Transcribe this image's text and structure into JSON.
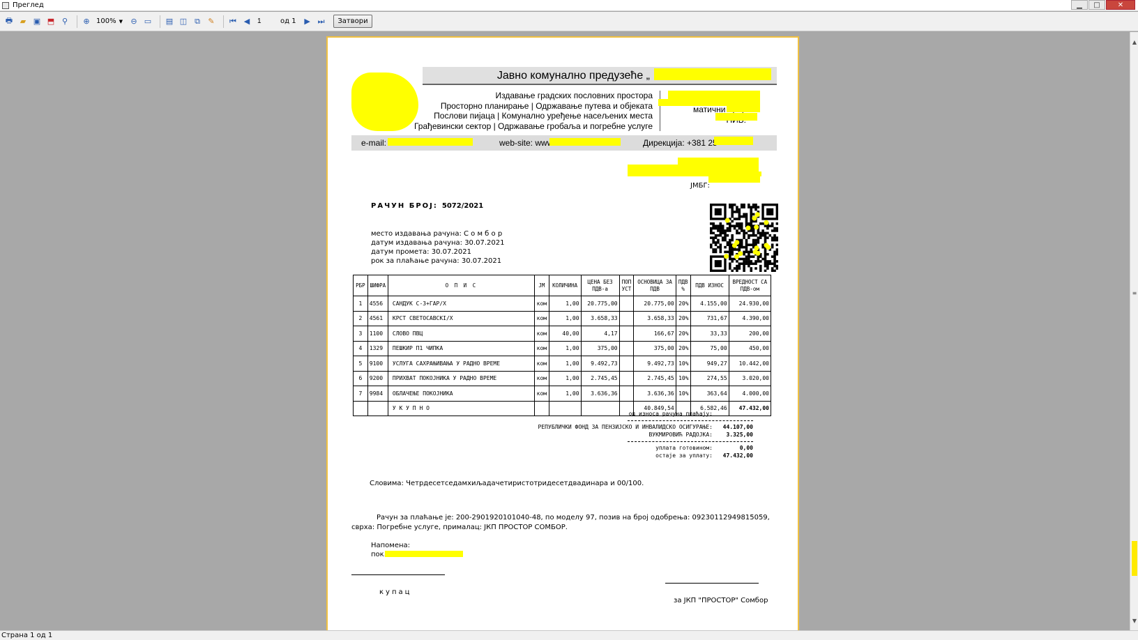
{
  "window": {
    "title": "Преглед",
    "zoom": "100%",
    "page_current": "1",
    "page_of": "од 1",
    "close_label": "Затвори",
    "status": "Страна 1 од 1"
  },
  "header": {
    "company": "Јавно комунално предузеће „",
    "services": [
      "Издавање градских пословних простора",
      "Просторно планирање | Одржавање путева и објеката",
      "Послови пијаца | Комунално уређење насељених места",
      "Грађевински сектор | Одржавање гробаља и погребне услуге"
    ],
    "maticni": "матични број:",
    "pib": "ПИБ:",
    "email": "e-mail:",
    "website": "web-site: www.",
    "direkcija": "Дирекција: +381 25"
  },
  "customer": {
    "jmbg": "ЈМБГ:"
  },
  "invoice": {
    "title": "РАЧУН БРОЈ:",
    "number": "5072/2021",
    "place": "место издавања рачуна: С о м б о р",
    "issue_date": "датум издавања рачуна: 30.07.2021",
    "turnover_date": "датум промета: 30.07.2021",
    "due_date": "рок за плаћање рачуна: 30.07.2021"
  },
  "table": {
    "headers": [
      "РБР",
      "ШИФРА",
      "О  П  И  С",
      "ЈМ",
      "КОЛИЧИНА",
      "ЦЕНА БЕЗ ПДВ-а",
      "ПОП УСТ",
      "ОСНОВИЦА ЗА ПДВ",
      "ПДВ %",
      "ПДВ ИЗНОС",
      "ВРЕДНОСТ СА ПДВ-ом"
    ],
    "rows": [
      [
        "1",
        "4556",
        "САНДУК С-3+ГАР/Х",
        "ком",
        "1,00",
        "20.775,00",
        "",
        "20.775,00",
        "20%",
        "4.155,00",
        "24.930,00"
      ],
      [
        "2",
        "4561",
        "КРСТ СВЕТОСАВСКI/Х",
        "ком",
        "1,00",
        "3.658,33",
        "",
        "3.658,33",
        "20%",
        "731,67",
        "4.390,00"
      ],
      [
        "3",
        "1100",
        "СЛОВО ПВЦ",
        "ком",
        "40,00",
        "4,17",
        "",
        "166,67",
        "20%",
        "33,33",
        "200,00"
      ],
      [
        "4",
        "1329",
        "ПЕШКИР П1 ЧИПКА",
        "ком",
        "1,00",
        "375,00",
        "",
        "375,00",
        "20%",
        "75,00",
        "450,00"
      ],
      [
        "5",
        "9100",
        "УСЛУГА САХРАЊИВАЊА У РАДНО ВРЕМЕ",
        "ком",
        "1,00",
        "9.492,73",
        "",
        "9.492,73",
        "10%",
        "949,27",
        "10.442,00"
      ],
      [
        "6",
        "9200",
        "ПРИХВАТ ПОКОЈНИКА У РАДНО ВРЕМЕ",
        "ком",
        "1,00",
        "2.745,45",
        "",
        "2.745,45",
        "10%",
        "274,55",
        "3.020,00"
      ],
      [
        "7",
        "9984",
        "ОБЛАЧЕЊЕ ПОКОЈНИКА",
        "ком",
        "1,00",
        "3.636,36",
        "",
        "3.636,36",
        "10%",
        "363,64",
        "4.000,00"
      ]
    ],
    "total_label": "У  К  У  П  Н  О",
    "total_base": "40.849,54",
    "total_vat": "6.582,46",
    "total_value": "47.432,00"
  },
  "payment": {
    "header": "од износа рачуна плаћају:",
    "payer1_label": "РЕПУБЛИЧКИ ФОНД ЗА ПЕНЗИЈСКО И ИНВАЛИДСКО ОСИГУРАЊЕ:",
    "payer1_value": "44.107,00",
    "payer2_label": "ВУКМИРОВИЋ РАДОЈКА:",
    "payer2_value": "3.325,00",
    "cash_label": "уплата готовином:",
    "cash_value": "0,00",
    "remaining_label": "остаје за уплату:",
    "remaining_value": "47.432,00"
  },
  "footer": {
    "in_words": "Словима:  Четрдесетседамхиљадачетиристотридесетдвадинара и  00/100.",
    "bank_info": "Рачун за плаћање је:  200-2901920101040-48,  по моделу 97, позив на број одобрења: 09230112949815059, сврха: Погребне услуге, прималац: ЈКП ПРОСТОР СОМБОР.",
    "note_label": "Напомена:",
    "note_text": "пок.",
    "buyer": "купац",
    "issuer": "за ЈКП \"ПРОСТОР\" Сомбор"
  }
}
